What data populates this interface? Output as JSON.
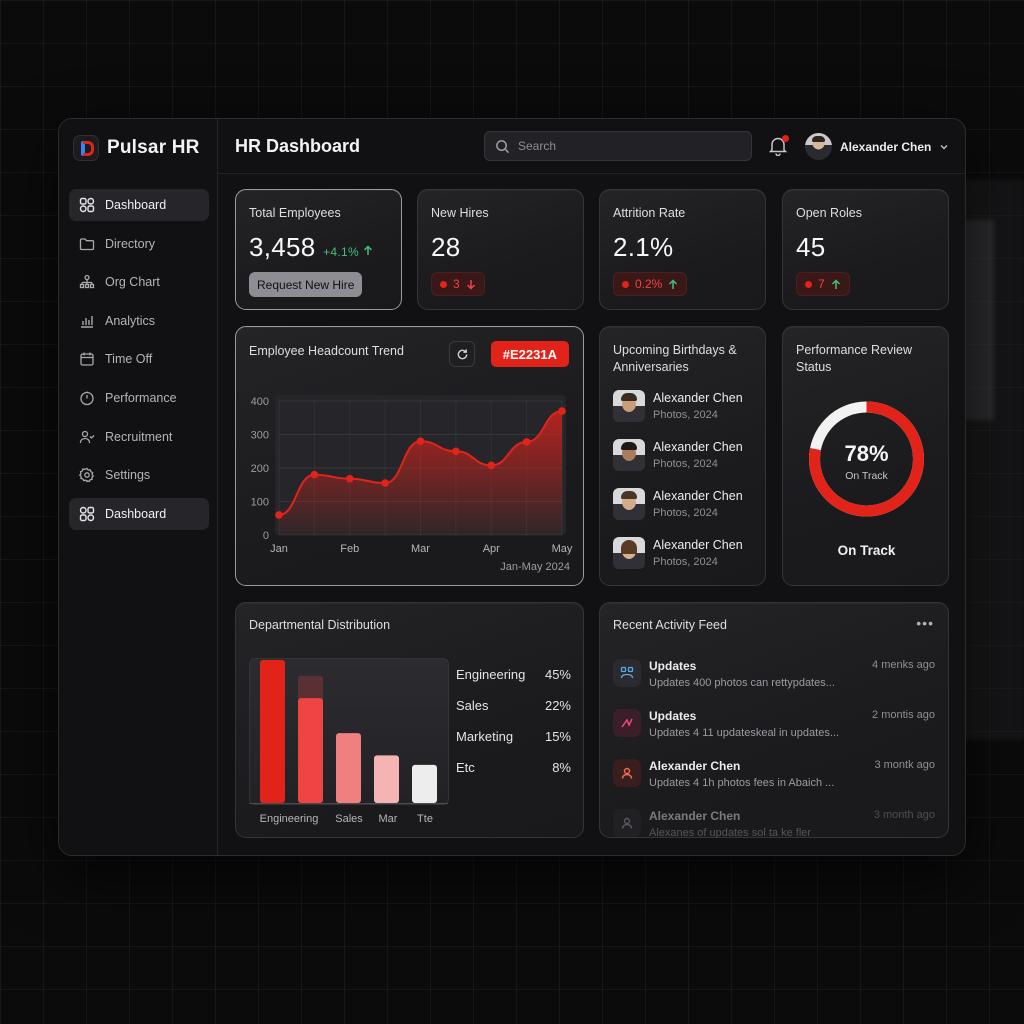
{
  "app": {
    "brand": "Pulsar HR",
    "title": "HR Dashboard"
  },
  "search": {
    "placeholder": "Search"
  },
  "user": {
    "name": "Alexander Chen"
  },
  "nav": [
    {
      "label": "Dashboard",
      "icon": "grid-icon",
      "active": true
    },
    {
      "label": "Directory",
      "icon": "folder-icon",
      "active": false
    },
    {
      "label": "Org Chart",
      "icon": "org-chart-icon",
      "active": false
    },
    {
      "label": "Analytics",
      "icon": "bar-chart-icon",
      "active": false
    },
    {
      "label": "Time Off",
      "icon": "calendar-icon",
      "active": false
    },
    {
      "label": "Performance",
      "icon": "timer-icon",
      "active": false
    },
    {
      "label": "Recruitment",
      "icon": "users-icon",
      "active": false
    },
    {
      "label": "Settings",
      "icon": "gear-icon",
      "active": false
    },
    {
      "label": "Dashboard",
      "icon": "grid-icon",
      "active": true
    }
  ],
  "stats": {
    "total_employees": {
      "label": "Total Employees",
      "value": "3,458",
      "delta": "+4.1%",
      "button": "Request New Hire"
    },
    "new_hires": {
      "label": "New Hires",
      "value": "28",
      "delta": "3"
    },
    "attrition": {
      "label": "Attrition Rate",
      "value": "2.1%",
      "delta": "0.2%"
    },
    "open_roles": {
      "label": "Open Roles",
      "value": "45",
      "delta": "7"
    }
  },
  "headcount": {
    "title": "Employee Headcount Trend",
    "chip": "#E2231A",
    "footer": "Jan-May 2024"
  },
  "birthdays": {
    "title": "Upcoming Birthdays & Anniversaries",
    "items": [
      {
        "name": "Alexander Chen",
        "sub": "Photos, 2024"
      },
      {
        "name": "Alexander Chen",
        "sub": "Photos, 2024"
      },
      {
        "name": "Alexander Chen",
        "sub": "Photos, 2024"
      },
      {
        "name": "Alexander Chen",
        "sub": "Photos, 2024"
      }
    ]
  },
  "performance": {
    "title": "Performance Review Status",
    "percent": "78%",
    "ring_label": "On Track",
    "caption": "On Track"
  },
  "departments": {
    "title": "Departmental Distribution",
    "legend": [
      {
        "name": "Engineering",
        "value": "45%"
      },
      {
        "name": "Sales",
        "value": "22%"
      },
      {
        "name": "Marketing",
        "value": "15%"
      },
      {
        "name": "Etc",
        "value": "8%"
      }
    ]
  },
  "feed": {
    "title": "Recent Activity Feed",
    "items": [
      {
        "title": "Updates",
        "desc": "Updates 400 photos can rettypdates...",
        "time": "4 menks ago"
      },
      {
        "title": "Updates",
        "desc": "Updates 4 11 updateskeal in updates...",
        "time": "2 montis ago"
      },
      {
        "title": "Alexander Chen",
        "desc": "Updates 4 1h photos fees in Abaich ...",
        "time": "3 montk ago"
      },
      {
        "title": "Alexander Chen",
        "desc": "Alexanes of updates sol ta ke fler",
        "time": "3 month ago"
      }
    ]
  },
  "colors": {
    "accent": "#E2231A",
    "positive": "#45C07A",
    "background": "#0B0B0C",
    "card": "#1E1E21"
  },
  "chart_data": [
    {
      "type": "area",
      "title": "Employee Headcount Trend",
      "x": [
        "Jan",
        "",
        "Feb",
        "",
        "Mar",
        "",
        "",
        "Apr",
        "",
        "May"
      ],
      "x_ticks": [
        "Jan",
        "Feb",
        "Mar",
        "Apr",
        "May"
      ],
      "values": [
        60,
        180,
        168,
        155,
        280,
        250,
        208,
        278,
        370
      ],
      "x_positions": [
        0,
        0.5,
        1,
        1.5,
        2,
        2.5,
        3,
        3.5,
        4
      ],
      "ylim": [
        0,
        400
      ],
      "y_ticks": [
        0,
        100,
        200,
        300,
        400
      ],
      "color": "#E2231A",
      "grid": true
    },
    {
      "type": "bar",
      "title": "Departmental Distribution",
      "categories": [
        "Engineering",
        "Sales",
        "Mar",
        "Tte"
      ],
      "values": [
        45,
        33,
        22,
        15,
        12
      ],
      "ghost_values": [
        0,
        40,
        0,
        0,
        0
      ],
      "ylim": [
        0,
        45
      ],
      "colors": [
        "#E2231A",
        "#EF4444",
        "#F08080",
        "#F4B4B4",
        "#EDEDED"
      ]
    },
    {
      "type": "pie",
      "title": "Performance Review Status",
      "values": [
        78,
        22
      ],
      "labels": [
        "On Track",
        ""
      ],
      "colors": [
        "#E2231A",
        "#F2F2F2"
      ]
    }
  ]
}
